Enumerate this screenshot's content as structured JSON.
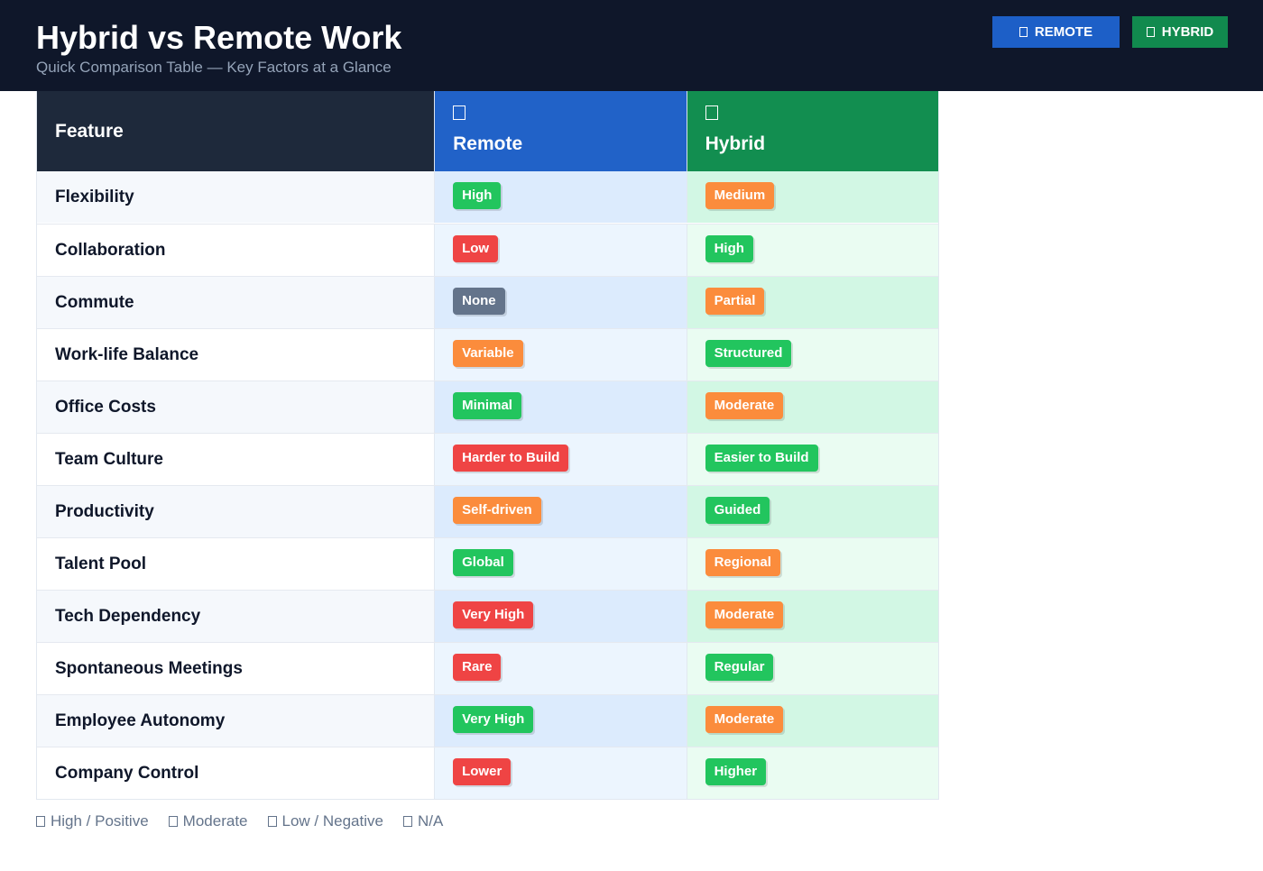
{
  "header": {
    "title": "Hybrid vs Remote Work",
    "subtitle": "Quick Comparison Table — Key Factors at a Glance",
    "buttons": {
      "remote": "REMOTE",
      "hybrid": "HYBRID"
    }
  },
  "table": {
    "columns": {
      "feature": "Feature",
      "remote": "Remote",
      "hybrid": "Hybrid"
    },
    "rows": [
      {
        "feature": "Flexibility",
        "remote": "High",
        "remote_color": "#22c55e",
        "hybrid": "Medium",
        "hybrid_color": "#fb8c3c"
      },
      {
        "feature": "Collaboration",
        "remote": "Low",
        "remote_color": "#ef4444",
        "hybrid": "High",
        "hybrid_color": "#22c55e"
      },
      {
        "feature": "Commute",
        "remote": "None",
        "remote_color": "#64748b",
        "hybrid": "Partial",
        "hybrid_color": "#fb8c3c"
      },
      {
        "feature": "Work-life Balance",
        "remote": "Variable",
        "remote_color": "#fb8c3c",
        "hybrid": "Structured",
        "hybrid_color": "#22c55e"
      },
      {
        "feature": "Office Costs",
        "remote": "Minimal",
        "remote_color": "#22c55e",
        "hybrid": "Moderate",
        "hybrid_color": "#fb8c3c"
      },
      {
        "feature": "Team Culture",
        "remote": "Harder to Build",
        "remote_color": "#ef4444",
        "hybrid": "Easier to Build",
        "hybrid_color": "#22c55e"
      },
      {
        "feature": "Productivity",
        "remote": "Self-driven",
        "remote_color": "#fb8c3c",
        "hybrid": "Guided",
        "hybrid_color": "#22c55e"
      },
      {
        "feature": "Talent Pool",
        "remote": "Global",
        "remote_color": "#22c55e",
        "hybrid": "Regional",
        "hybrid_color": "#fb8c3c"
      },
      {
        "feature": "Tech Dependency",
        "remote": "Very High",
        "remote_color": "#ef4444",
        "hybrid": "Moderate",
        "hybrid_color": "#fb8c3c"
      },
      {
        "feature": "Spontaneous Meetings",
        "remote": "Rare",
        "remote_color": "#ef4444",
        "hybrid": "Regular",
        "hybrid_color": "#22c55e"
      },
      {
        "feature": "Employee Autonomy",
        "remote": "Very High",
        "remote_color": "#22c55e",
        "hybrid": "Moderate",
        "hybrid_color": "#fb8c3c"
      },
      {
        "feature": "Company Control",
        "remote": "Lower",
        "remote_color": "#ef4444",
        "hybrid": "Higher",
        "hybrid_color": "#22c55e"
      }
    ]
  },
  "legend": [
    {
      "label": "High / Positive"
    },
    {
      "label": "Moderate"
    },
    {
      "label": "Low / Negative"
    },
    {
      "label": "N/A"
    }
  ],
  "colors": {
    "header_bg": "#0f172a",
    "remote_accent": "#1d5fc7",
    "hybrid_accent": "#118a4e",
    "positive": "#22c55e",
    "moderate": "#fb8c3c",
    "negative": "#ef4444",
    "neutral": "#64748b"
  }
}
